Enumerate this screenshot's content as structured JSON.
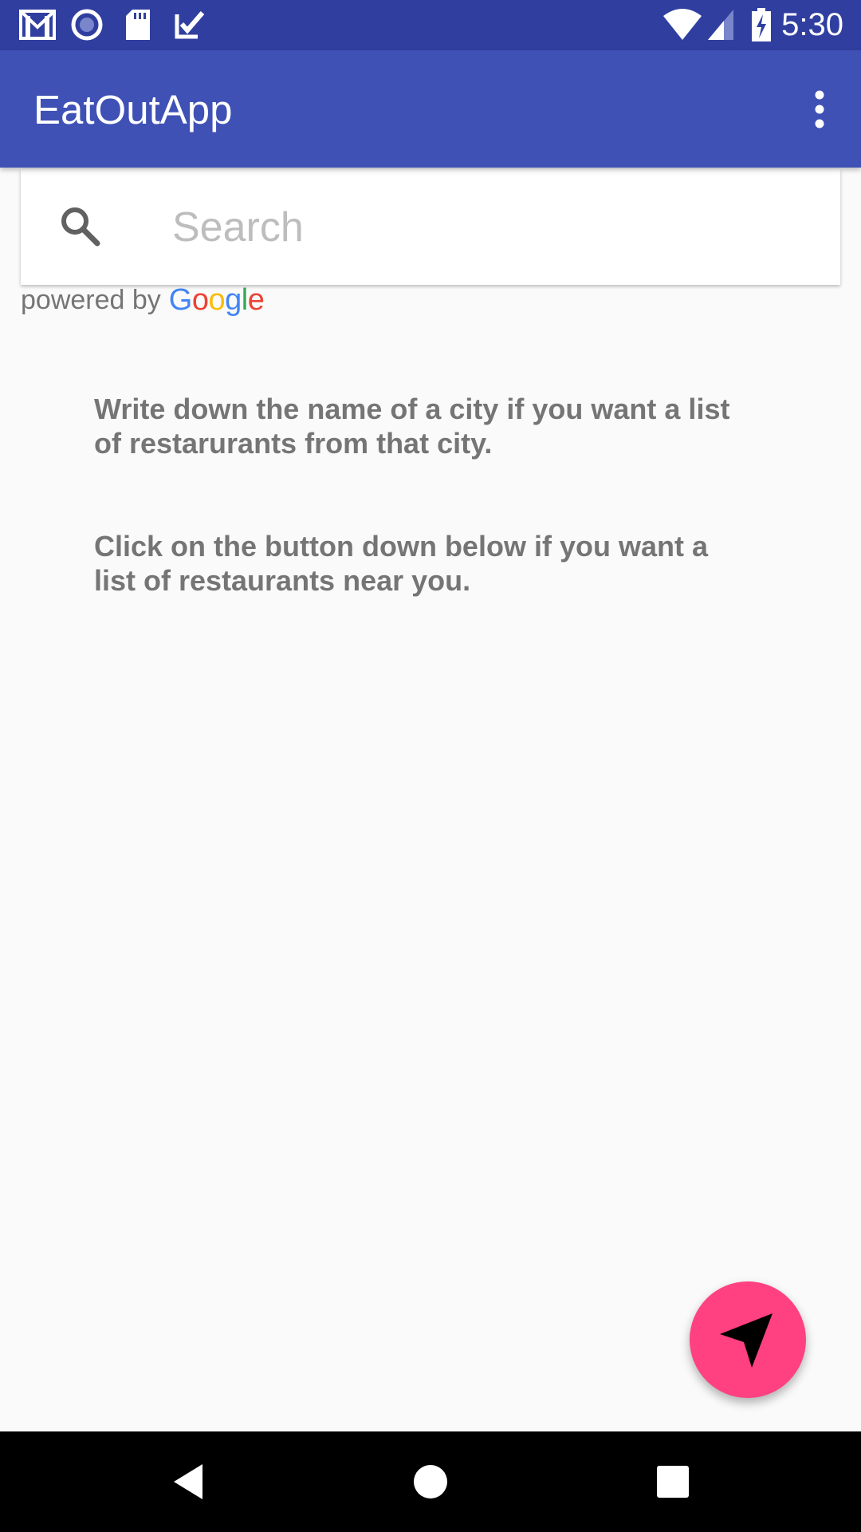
{
  "status_bar": {
    "time": "5:30",
    "left_icons": [
      "gmail-icon",
      "record-icon",
      "sd-card-icon",
      "task-check-icon"
    ],
    "right_icons": [
      "wifi-icon",
      "cell-signal-icon",
      "battery-charging-icon"
    ],
    "background_color": "#303F9F"
  },
  "app_bar": {
    "title": "EatOutApp",
    "menu_icon": "more-vert-icon",
    "background_color": "#3F51B5"
  },
  "search": {
    "placeholder": "Search",
    "value": "",
    "icon": "search-icon"
  },
  "attribution": {
    "powered_by": "powered by",
    "google_letters": [
      "G",
      "o",
      "o",
      "g",
      "l",
      "e"
    ]
  },
  "instructions": [
    "Write down the name of a city if you want a list of restarurants from that city.",
    "Click on the button down below if you want a list of restaurants near you."
  ],
  "fab": {
    "icon": "navigation-arrow-icon",
    "color": "#FF4081"
  },
  "nav_bar": {
    "buttons": [
      "back-icon",
      "home-icon",
      "recents-icon"
    ]
  }
}
